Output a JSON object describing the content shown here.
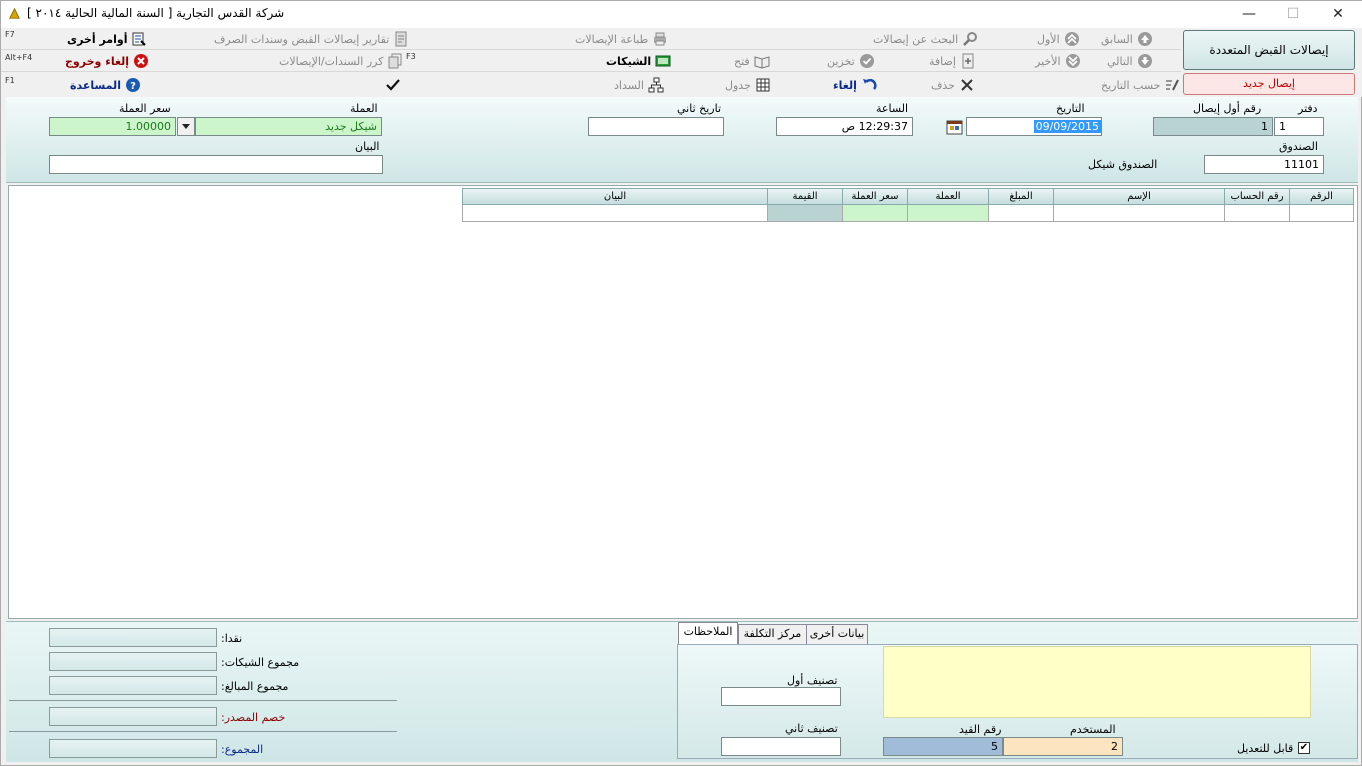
{
  "window": {
    "title": "شركة القدس التجارية [ السنة المالية الحالية ٢٠١٤ ]",
    "minimize": "—",
    "maximize": "☐",
    "close": "✕"
  },
  "toolbar": {
    "row1": {
      "prev": "السابق",
      "first": "الأول",
      "search": "البحث عن إيصالات",
      "print": "طباعة الإيصالات",
      "reports": "تقارير إيصالات القبض وسندات الصرف",
      "other": "أوامر أخرى",
      "other_key": "F7"
    },
    "row2": {
      "next": "التالي",
      "last": "الأخير",
      "add": "إضافة",
      "store": "تخزين",
      "open": "فتح",
      "cheques": "الشيكات",
      "repeat": "كرر السندات/الإيصالات",
      "repeat_key": "F3",
      "cancel_exit": "إلغاء وخروج",
      "cancel_exit_key": "Alt+F4"
    },
    "row3": {
      "by_date": "حسب التاريخ",
      "delete": "حذف",
      "cancel": "إلغاء",
      "table": "جدول",
      "payment": "السداد",
      "help": "المساعدة",
      "help_key": "F1"
    },
    "big_button": "إيصالات القبض المتعددة",
    "new_button": "إيصال جديد"
  },
  "form": {
    "book_label": "دفتر",
    "book_value": "1",
    "first_receipt_label": "رقم أول إيصال",
    "first_receipt_value": "1",
    "date_label": "التاريخ",
    "date_value": "09/09/2015",
    "time_label": "الساعة",
    "time_value": "12:29:37 ص",
    "second_date_label": "تاريخ ثاني",
    "second_date_value": "",
    "currency_label": "العملة",
    "currency_value": "شيكل جديد",
    "rate_label": "سعر العملة",
    "rate_value": "1.00000",
    "cashbox_label": "الصندوق",
    "cashbox_value": "11101",
    "cashbox_name": "الصندوق شيكل",
    "statement_label": "البيان",
    "statement_value": ""
  },
  "grid": {
    "columns": [
      "الرقم",
      "رقم الحساب",
      "الإسم",
      "المبلغ",
      "العملة",
      "سعر العملة",
      "القيمة",
      "البيان"
    ]
  },
  "summary": {
    "cash_label": "نقدا:",
    "cheques_total_label": "مجموع الشيكات:",
    "amounts_total_label": "مجموع المبالغ:",
    "source_discount_label": "خصم المصدر:",
    "total_label": "المجموع:"
  },
  "tabs": {
    "notes": "الملاحظات",
    "cost_center": "مركز التكلفة",
    "other_data": "بيانات أخرى"
  },
  "notes_panel": {
    "class1_label": "تصنيف أول",
    "class2_label": "تصنيف ثاني",
    "user_label": "المستخدم",
    "user_value": "2",
    "entry_no_label": "رقم القيد",
    "entry_no_value": "5",
    "editable_label": "قابل للتعديل",
    "editable_check": "✔"
  },
  "colors": {
    "accent_teal": "#cfe6e6",
    "new_receipt_red": "#c00000",
    "help_blue": "#0a2a8a",
    "exit_red": "#8b0000",
    "currency_green": "#1a7a1a"
  }
}
